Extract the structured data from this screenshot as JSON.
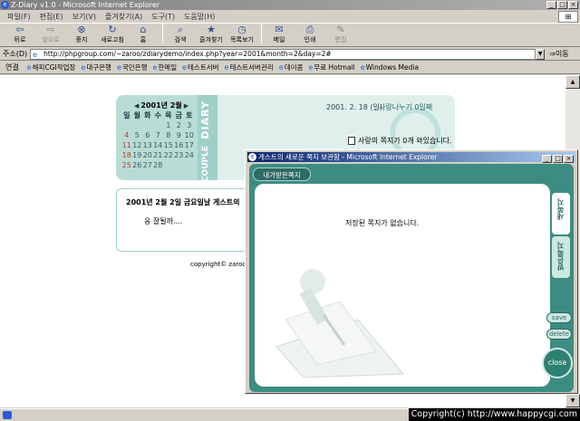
{
  "window": {
    "title": "Z-Diary v1.0 - Microsoft Internet Explorer"
  },
  "menu": [
    "파일(F)",
    "편집(E)",
    "보기(V)",
    "즐겨찾기(A)",
    "도구(T)",
    "도움말(H)"
  ],
  "toolbar": {
    "back": "뒤로",
    "forward": "앞으로",
    "stop": "중지",
    "refresh": "새로고침",
    "home": "홈",
    "search": "검색",
    "favorites": "즐겨찾기",
    "history": "목록보기",
    "mail": "메일",
    "print": "인쇄",
    "edit": "편집"
  },
  "address": {
    "label": "주소(D)",
    "url": "http://phpgroup.com/~zaroo/zdiarydemo/index.php?year=2001&month=2&day=2#",
    "go": "이동"
  },
  "links": {
    "label": "연결",
    "items": [
      "해피CGI작업장",
      "대구은행",
      "국민은행",
      "한메일",
      "테스트서버",
      "테스트서버관리",
      "데이콤",
      "무료 Hotmail",
      "Windows Media"
    ]
  },
  "calendar": {
    "header": "2001년 2월",
    "weekdays": [
      "일",
      "월",
      "화",
      "수",
      "목",
      "금",
      "토"
    ],
    "rows": [
      [
        "",
        "",
        "",
        "",
        "1",
        "2",
        "3"
      ],
      [
        "4",
        "5",
        "6",
        "7",
        "8",
        "9",
        "10"
      ],
      [
        "11",
        "12",
        "13",
        "14",
        "15",
        "16",
        "17"
      ],
      [
        "18",
        "19",
        "20",
        "21",
        "22",
        "23",
        "24"
      ],
      [
        "25",
        "26",
        "27",
        "28",
        "",
        "",
        ""
      ]
    ],
    "logo_text": "DIARY",
    "logo_sub": "THECOUPLE"
  },
  "diary": {
    "date_label": "2001. 2. 18 (일)",
    "share_label": "사랑나누기 0일째",
    "message": "사랑의 쪽지가 0개 와있습니다."
  },
  "note": {
    "title": "2001년 2월 2일 금요일날 게스트의",
    "body": "응 잘될까...."
  },
  "page_copyright": "copyright© zaroo.",
  "popup": {
    "title": "게스트의 새로운 쪽지 보관함 - Microsoft Internet Explorer",
    "tab_label": "내가받은쪽지",
    "message": "저장된 쪽지가 없습니다.",
    "side_tab_1": "새쪽지",
    "side_tab_2": "받은쪽지",
    "save": "save",
    "delete": "delete",
    "close": "close"
  },
  "overlay_copyright": "Copyright(c) http://www.happycgi.com"
}
